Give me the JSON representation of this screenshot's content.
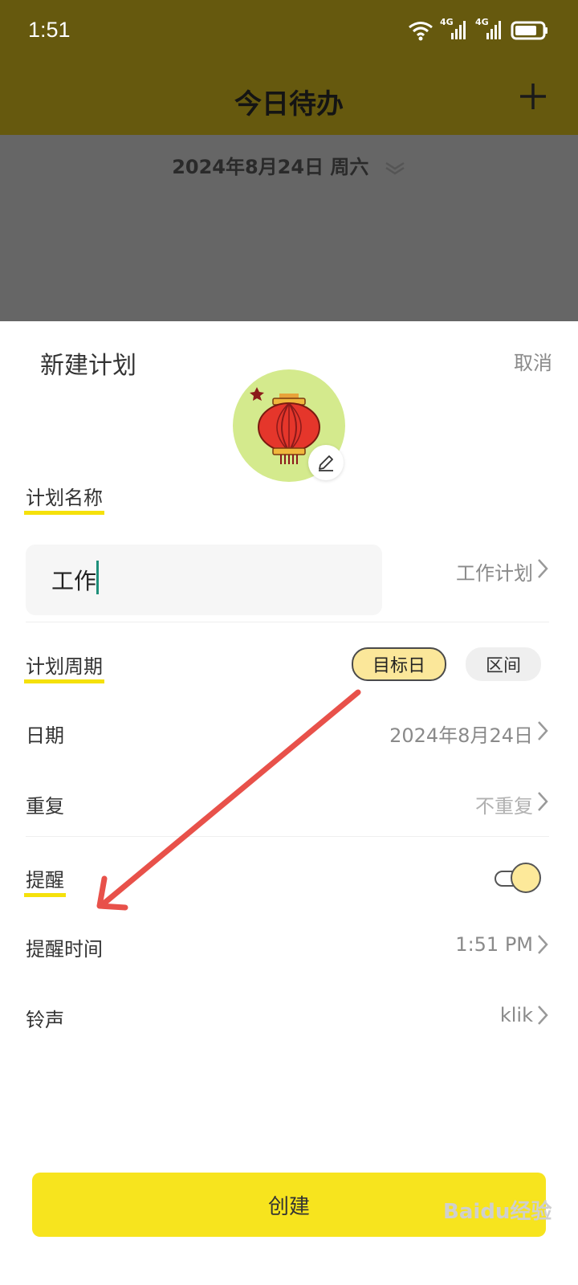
{
  "status_bar": {
    "time": "1:51",
    "signal1": "4G",
    "signal2": "4G"
  },
  "header": {
    "title": "今日待办",
    "add_icon": "plus-icon"
  },
  "date_bar": {
    "date": "2024年8月24日 周六",
    "expand_icon": "double-chevron-down-icon"
  },
  "sheet": {
    "title": "新建计划",
    "cancel": "取消",
    "avatar_icon": "lantern-icon",
    "edit_icon": "pencil-icon"
  },
  "plan_name": {
    "label": "计划名称",
    "value": "工作",
    "suggestion": "工作计划"
  },
  "cycle": {
    "label": "计划周期",
    "options": [
      "目标日",
      "区间"
    ],
    "selected": "目标日"
  },
  "date": {
    "label": "日期",
    "value": "2024年8月24日"
  },
  "repeat": {
    "label": "重复",
    "value": "不重复"
  },
  "reminder": {
    "label": "提醒",
    "enabled": true
  },
  "reminder_time": {
    "label": "提醒时间",
    "value": "1:51 PM"
  },
  "ringtone": {
    "label": "铃声",
    "value": "klik"
  },
  "create_button": "创建",
  "watermark": "Baidu经验",
  "colors": {
    "accent_yellow": "#f7e41e",
    "header_olive": "#66590e",
    "annotation_arrow": "#e8514a"
  }
}
